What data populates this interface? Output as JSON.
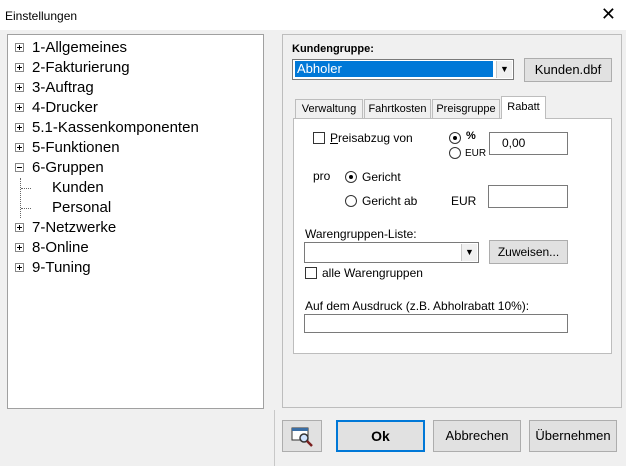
{
  "window": {
    "title": "Einstellungen",
    "close_symbol": "✕"
  },
  "tree": {
    "items": [
      {
        "label": "1-Allgemeines",
        "expander": "+"
      },
      {
        "label": "2-Fakturierung",
        "expander": "+"
      },
      {
        "label": "3-Auftrag",
        "expander": "+"
      },
      {
        "label": "4-Drucker",
        "expander": "+"
      },
      {
        "label": "5.1-Kassenkomponenten",
        "expander": "+"
      },
      {
        "label": "5-Funktionen",
        "expander": "+"
      },
      {
        "label": "6-Gruppen",
        "expander": "-"
      },
      {
        "label": "Kunden",
        "selected": true
      },
      {
        "label": "Personal"
      },
      {
        "label": "7-Netzwerke",
        "expander": "+"
      },
      {
        "label": "8-Online",
        "expander": "+"
      },
      {
        "label": "9-Tuning",
        "expander": "+"
      }
    ]
  },
  "kundengruppe": {
    "label": "Kundengruppe:",
    "value": "Abholer",
    "dbf_button": "Kunden.dbf"
  },
  "tabs": [
    {
      "label": "Verwaltung"
    },
    {
      "label": "Fahrtkosten"
    },
    {
      "label": "Preisgruppe"
    },
    {
      "label": "Rabatt",
      "active": true
    }
  ],
  "rabatt": {
    "preisabzug_label": "Preisabzug von",
    "preisabzug_checked": false,
    "percent_label": "%",
    "eur_small_label": "EUR",
    "percent_selected": true,
    "amount_value": "0,00",
    "pro_label": "pro",
    "gericht_label": "Gericht",
    "gericht_checked": true,
    "gericht_ab_label": "Gericht ab",
    "gericht_ab_checked": false,
    "eur_label": "EUR",
    "eur_value": "",
    "warengruppen_label": "Warengruppen-Liste:",
    "warengruppen_value": "",
    "zuweisen_button": "Zuweisen...",
    "alle_warengruppen_label": "alle Warengruppen",
    "alle_warengruppen_checked": false,
    "ausdruck_label": "Auf dem Ausdruck (z.B. Abholrabatt 10%):",
    "ausdruck_value": ""
  },
  "footer": {
    "ok_button": "Ok",
    "abbrechen_button": "Abbrechen",
    "uebernehmen_button": "Übernehmen"
  },
  "colors": {
    "accent": "#0078d7",
    "border": "#adadad",
    "background": "#f0f0f0"
  }
}
